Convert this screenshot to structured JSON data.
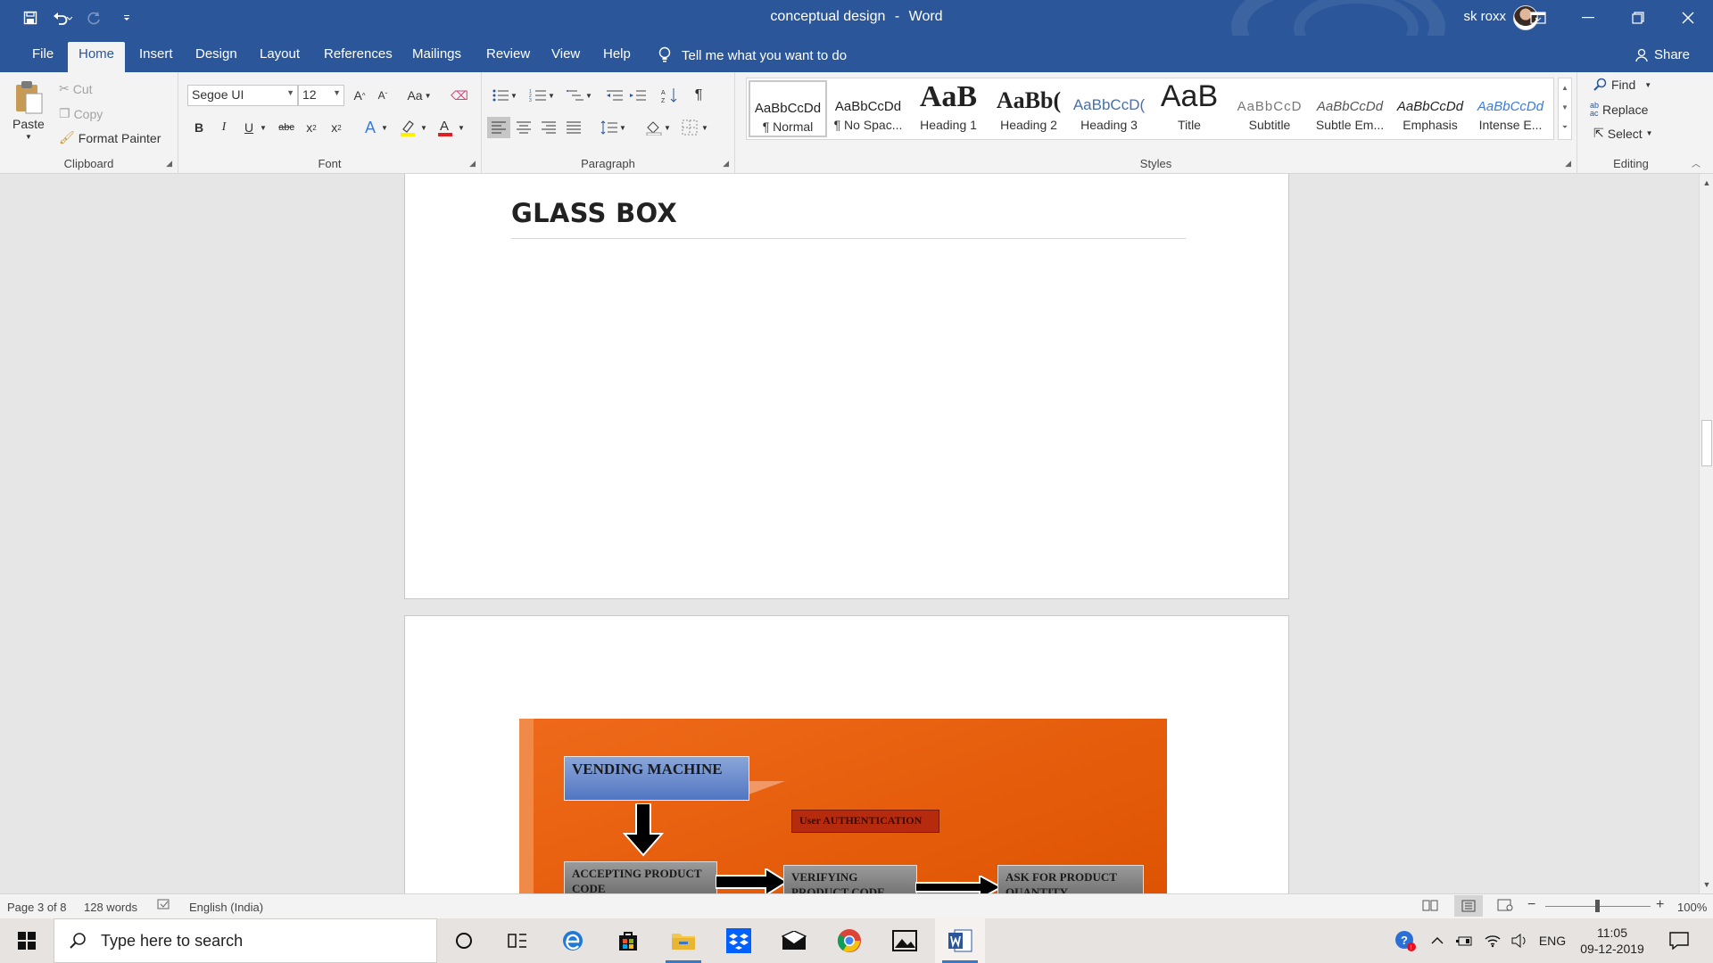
{
  "window": {
    "doc_title": "conceptual design",
    "separator": "-",
    "app_name": "Word",
    "user_name": "sk roxx"
  },
  "tabs": [
    "File",
    "Home",
    "Insert",
    "Design",
    "Layout",
    "References",
    "Mailings",
    "Review",
    "View",
    "Help"
  ],
  "active_tab": "Home",
  "tell_me": "Tell me what you want to do",
  "share_label": "Share",
  "clipboard": {
    "paste": "Paste",
    "cut": "Cut",
    "copy": "Copy",
    "format_painter": "Format Painter",
    "group_label": "Clipboard"
  },
  "font": {
    "name": "Segoe UI",
    "size": "12",
    "group_label": "Font",
    "bold": "B",
    "italic": "I",
    "underline": "U",
    "strike": "abc",
    "change_case": "Aa"
  },
  "paragraph": {
    "group_label": "Paragraph"
  },
  "styles": {
    "group_label": "Styles",
    "items": [
      {
        "preview": "AaBbCcDd",
        "name": "¶ Normal"
      },
      {
        "preview": "AaBbCcDd",
        "name": "¶ No Spac..."
      },
      {
        "preview": "AaB",
        "name": "Heading 1"
      },
      {
        "preview": "AaBb(",
        "name": "Heading 2"
      },
      {
        "preview": "AaBbCcD(",
        "name": "Heading 3"
      },
      {
        "preview": "AaB",
        "name": "Title"
      },
      {
        "preview": "AaBbCcD",
        "name": "Subtitle"
      },
      {
        "preview": "AaBbCcDd",
        "name": "Subtle Em..."
      },
      {
        "preview": "AaBbCcDd",
        "name": "Emphasis"
      },
      {
        "preview": "AaBbCcDd",
        "name": "Intense E..."
      }
    ]
  },
  "editing": {
    "group_label": "Editing",
    "find": "Find",
    "replace": "Replace",
    "select": "Select"
  },
  "document": {
    "heading": "GLASS BOX",
    "diagram": {
      "vending": "VENDING MACHINE",
      "auth": "User AUTHENTICATION",
      "accepting": "ACCEPTING PRODUCT CODE",
      "verifying": "VERIFYING PRODUCT CODE",
      "ask": "ASK FOR PRODUCT QUANTITY"
    }
  },
  "status": {
    "page": "Page 3 of 8",
    "words": "128 words",
    "language": "English (India)",
    "zoom": "100%"
  },
  "taskbar": {
    "search_placeholder": "Type here to search",
    "time": "11:05",
    "date": "09-12-2019",
    "lang": "ENG"
  },
  "colors": {
    "word_blue": "#2b579a",
    "diagram_orange": "#e35a08",
    "auth_red": "#b62a0e"
  }
}
